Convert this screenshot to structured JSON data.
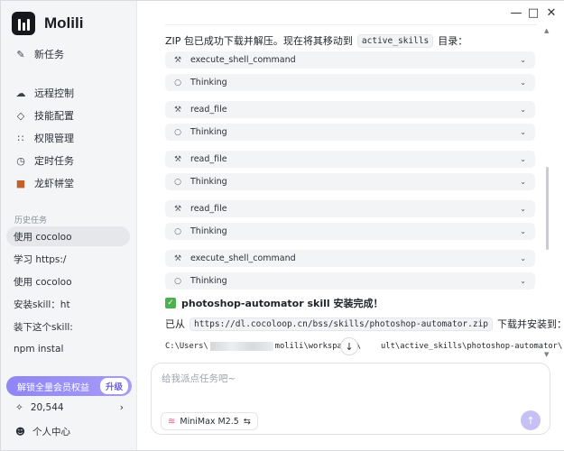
{
  "app": {
    "name": "Molili"
  },
  "sidebar": {
    "new_task": "新任务",
    "items": [
      {
        "label": "远程控制",
        "icon": "cloud-icon"
      },
      {
        "label": "技能配置",
        "icon": "diamond-icon"
      },
      {
        "label": "权限管理",
        "icon": "grid-icon"
      },
      {
        "label": "定时任务",
        "icon": "clock-icon"
      },
      {
        "label": "龙虾帡堂",
        "icon": "lobster-icon"
      }
    ],
    "history_title": "历史任务",
    "history": [
      "使用 cocoloo",
      "学习 https:/",
      "使用 cocoloo",
      "安装skill：ht",
      "装下这个skill:",
      "npm instal"
    ],
    "promo_text": "解锁全量会员权益",
    "promo_button": "升级",
    "credits": "20,544",
    "user_center": "个人中心"
  },
  "main": {
    "intro": {
      "before": "ZIP 包已成功下载并解压。现在将其移动到",
      "code": "active_skills",
      "after": "目录："
    },
    "tools": [
      {
        "label": "execute_shell_command",
        "icon": "wrench-icon"
      },
      {
        "label": "Thinking",
        "icon": "bulb-icon"
      },
      {
        "label": "read_file",
        "icon": "wrench-icon"
      },
      {
        "label": "Thinking",
        "icon": "bulb-icon"
      },
      {
        "label": "read_file",
        "icon": "wrench-icon"
      },
      {
        "label": "Thinking",
        "icon": "bulb-icon"
      },
      {
        "label": "read_file",
        "icon": "wrench-icon"
      },
      {
        "label": "Thinking",
        "icon": "bulb-icon"
      },
      {
        "label": "execute_shell_command",
        "icon": "wrench-icon"
      },
      {
        "label": "Thinking",
        "icon": "bulb-icon"
      }
    ],
    "done_text": "photoshop-automator skill 安装完成！",
    "from_line": {
      "before": "已从",
      "code": "https://dl.cocoloop.cn/bss/skills/photoshop-automator.zip",
      "after": "下载并安装到："
    },
    "path_prefix": "C:\\Users\\",
    "path_suffix": "molili\\workspaces\\",
    "path_end": "ult\\active_skills\\photoshop-automator\\"
  },
  "composer": {
    "placeholder": "给我派点任务吧~",
    "model": "MiniMax M2.5"
  },
  "colors": {
    "accent": "#8f85f5",
    "send_disabled": "#c7c0f5",
    "success": "#4cb050"
  }
}
